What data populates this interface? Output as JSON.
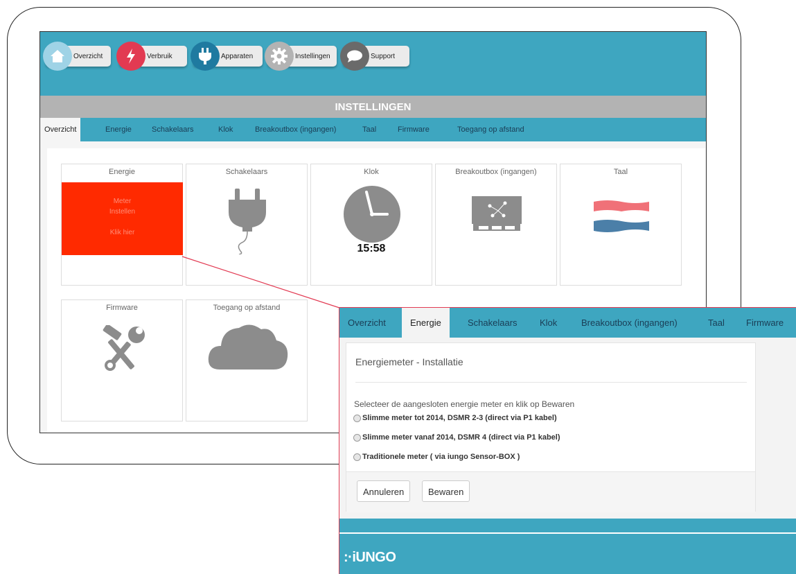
{
  "topnav": [
    {
      "label": "Overzicht",
      "icon": "home-icon",
      "color": "#9fd3e6"
    },
    {
      "label": "Verbruik",
      "icon": "lightning-icon",
      "color": "#e23a52"
    },
    {
      "label": "Apparaten",
      "icon": "plug-icon",
      "color": "#1f7aa0"
    },
    {
      "label": "Instellingen",
      "icon": "gear-icon",
      "color": "#b3b3b3"
    },
    {
      "label": "Support",
      "icon": "chat-bubble-icon",
      "color": "#6a6a6a"
    }
  ],
  "banner": {
    "title": "INSTELLINGEN"
  },
  "tabs": [
    "Overzicht",
    "Energie",
    "Schakelaars",
    "Klok",
    "Breakoutbox (ingangen)",
    "Taal",
    "Firmware",
    "Toegang op afstand"
  ],
  "tiles": {
    "energie": {
      "title": "Energie",
      "line1": "Meter",
      "line2": "Instellen",
      "line3": "Klik hier",
      "color": "#ff2a00"
    },
    "schakelaars": {
      "title": "Schakelaars",
      "icon": "plug-icon"
    },
    "klok": {
      "title": "Klok",
      "time": "15:58",
      "icon": "clock-icon"
    },
    "breakoutbox": {
      "title": "Breakoutbox (ingangen)",
      "icon": "breakoutbox-icon"
    },
    "taal": {
      "title": "Taal",
      "icon": "dutch-flag-icon"
    },
    "firmware": {
      "title": "Firmware",
      "icon": "tools-icon"
    },
    "toegang": {
      "title": "Toegang op afstand",
      "icon": "cloud-icon"
    }
  },
  "zoom": {
    "tabs": [
      "Overzicht",
      "Energie",
      "Schakelaars",
      "Klok",
      "Breakoutbox (ingangen)",
      "Taal",
      "Firmware"
    ],
    "heading": "Energiemeter - Installatie",
    "intro": "Selecteer de aangesloten energie meter en klik op Bewaren",
    "options": [
      "Slimme meter tot 2014, DSMR 2-3 (direct via P1 kabel)",
      "Slimme meter vanaf 2014, DSMR 4 (direct via P1 kabel)",
      "Traditionele meter ( via iungo Sensor-BOX )"
    ],
    "cancel_label": "Annuleren",
    "save_label": "Bewaren",
    "logo": ":·iUNGO"
  },
  "colors": {
    "teal": "#3ea6c0",
    "highlight_line": "#e23a52",
    "tab_text": "#1a3d55"
  }
}
